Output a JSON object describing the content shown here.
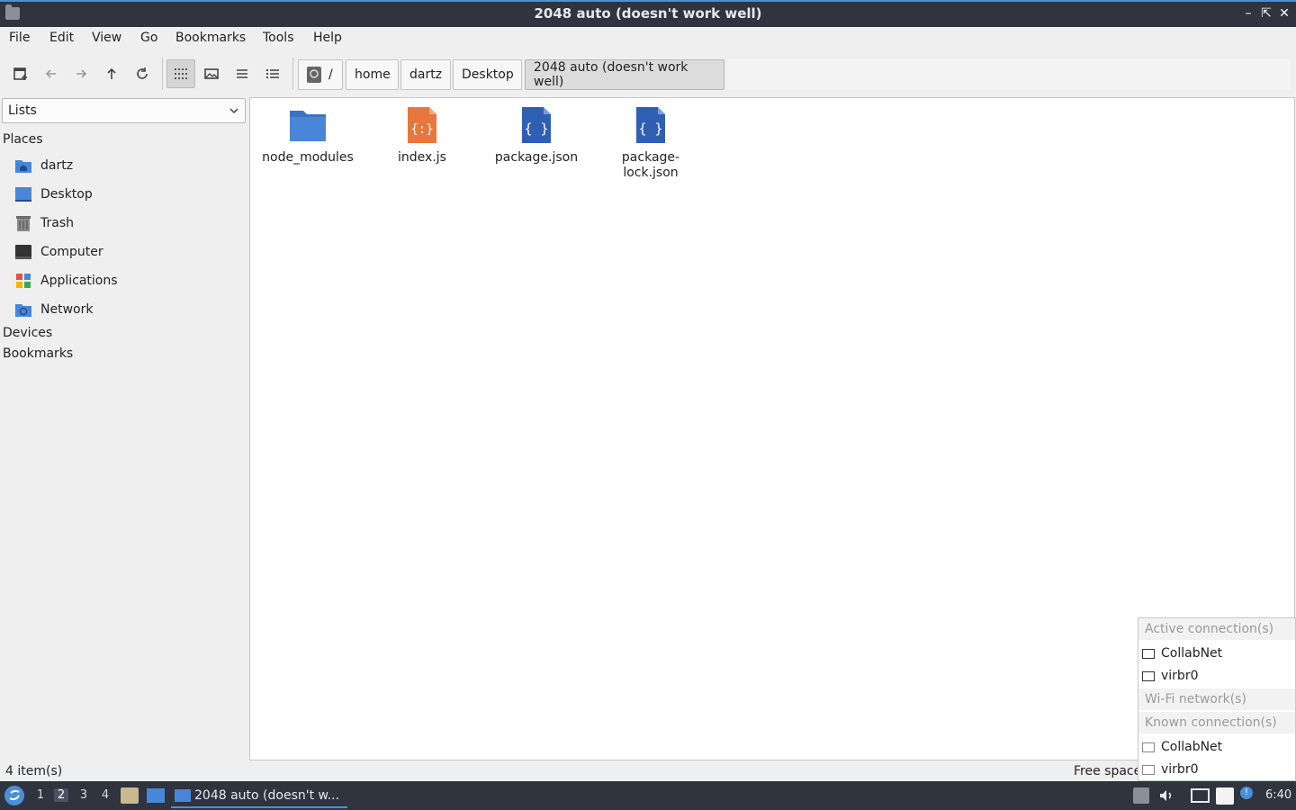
{
  "window": {
    "title": "2048 auto (doesn't work well)"
  },
  "menu": {
    "file": "File",
    "edit": "Edit",
    "view": "View",
    "go": "Go",
    "bookmarks": "Bookmarks",
    "tools": "Tools",
    "help": "Help"
  },
  "breadcrumb": {
    "root": "/",
    "c1": "home",
    "c2": "dartz",
    "c3": "Desktop",
    "c4": "2048 auto (doesn't work well)"
  },
  "sidebar": {
    "mode": "Lists",
    "places_heading": "Places",
    "places": [
      {
        "label": "dartz",
        "icon": "home-folder-icon"
      },
      {
        "label": "Desktop",
        "icon": "desktop-icon"
      },
      {
        "label": "Trash",
        "icon": "trash-icon"
      },
      {
        "label": "Computer",
        "icon": "computer-icon"
      },
      {
        "label": "Applications",
        "icon": "applications-icon"
      },
      {
        "label": "Network",
        "icon": "network-icon"
      }
    ],
    "devices_heading": "Devices",
    "bookmarks_heading": "Bookmarks"
  },
  "files": [
    {
      "name": "node_modules",
      "type": "folder"
    },
    {
      "name": "index.js",
      "type": "javascript"
    },
    {
      "name": "package.json",
      "type": "json"
    },
    {
      "name": "package-\nlock.json",
      "type": "json"
    }
  ],
  "status": {
    "items": "4 item(s)",
    "free_space": "Free space"
  },
  "network_popup": {
    "active_heading": "Active connection(s)",
    "active": [
      "CollabNet",
      "virbr0"
    ],
    "wifi_heading": "Wi-Fi network(s)",
    "known_heading": "Known connection(s)",
    "known": [
      "CollabNet",
      "virbr0"
    ]
  },
  "taskbar": {
    "workspaces": [
      "1",
      "2",
      "3",
      "4"
    ],
    "active_workspace": "2",
    "task_label": "2048 auto (doesn't w...",
    "clock": "6:40"
  },
  "colors": {
    "accent": "#4a90d9",
    "panel": "#2f343f",
    "folder": "#4a86d8",
    "js": "#e8773d",
    "json": "#2f5fb3"
  }
}
